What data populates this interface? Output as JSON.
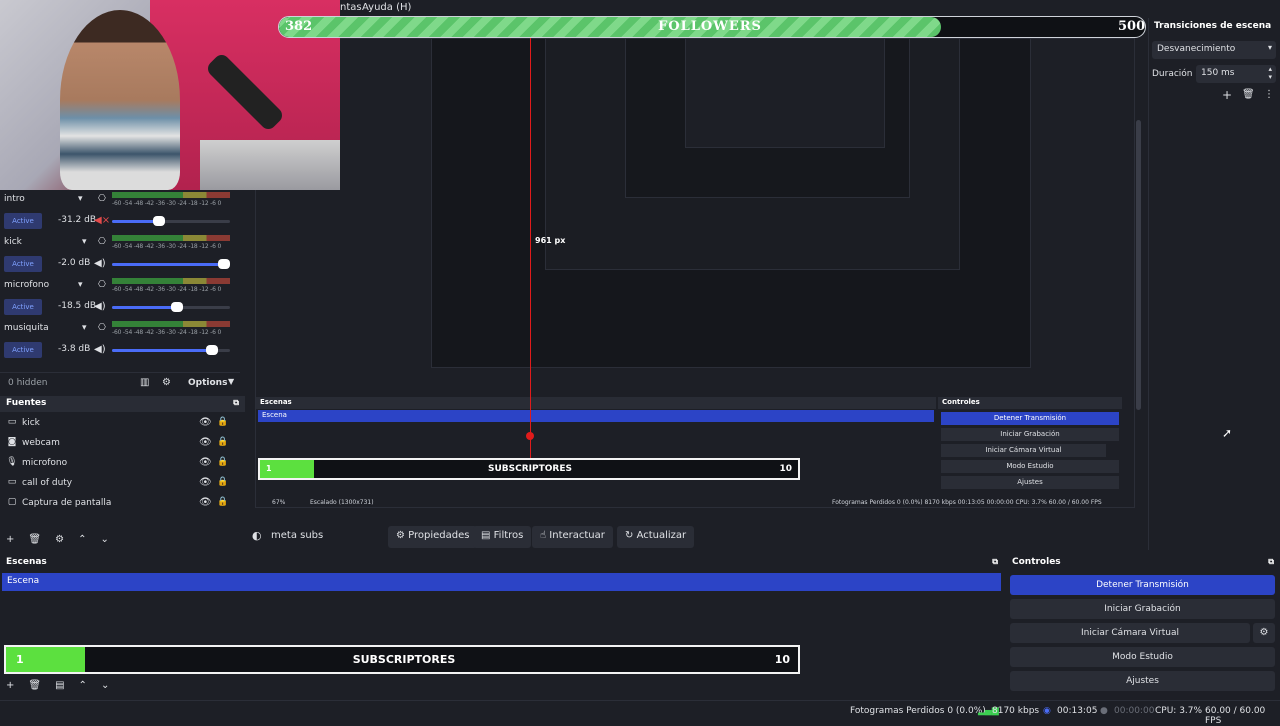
{
  "menu": {
    "items": [
      "ntas",
      "Ayuda (H)"
    ]
  },
  "followers": {
    "current": "382",
    "title": "FOLLOWERS",
    "goal": "500",
    "progress": 0.764
  },
  "mixer": {
    "rows": [
      {
        "name": "intro",
        "state": "Active",
        "db": "-31.2 dB",
        "level": 0.4
      },
      {
        "name": "kick",
        "state": "Active",
        "db": "-2.0 dB",
        "level": 0.95
      },
      {
        "name": "microfono",
        "state": "Active",
        "db": "-18.5 dB",
        "level": 0.55
      },
      {
        "name": "musiquita",
        "state": "Active",
        "db": "-3.8 dB",
        "level": 0.85
      }
    ],
    "scale": "-60 -54 -48 -42 -36 -30 -24 -18 -12 -6 0",
    "hidden": "0 hidden",
    "options": "Options"
  },
  "fuentes": {
    "title": "Fuentes",
    "items": [
      {
        "label": "kick",
        "icon": "display-icon"
      },
      {
        "label": "webcam",
        "icon": "camera-icon"
      },
      {
        "label": "microfono",
        "icon": "mic-icon"
      },
      {
        "label": "call of duty",
        "icon": "display-icon"
      },
      {
        "label": "Captura de pantalla",
        "icon": "monitor-icon"
      }
    ]
  },
  "inner": {
    "escenas_title": "Escenas",
    "escena": "Escena",
    "controles_title": "Controles",
    "controls": [
      "Detener Transmisión",
      "Iniciar Grabación",
      "Iniciar Cámara Virtual",
      "Modo Estudio",
      "Ajustes"
    ],
    "subs_current": "1",
    "subs_title": "SUBSCRIPTORES",
    "subs_goal": "10",
    "zoom": "67%",
    "scale_label": "Escalado (1300x731)",
    "status": "Fotogramas Perdidos 0 (0.0%)   8170 kbps   00:13:05   00:00:00   CPU: 3.7%   60.00 / 60.00 FPS",
    "px_label": "961 px"
  },
  "toolbar": {
    "source_name": "meta subs",
    "propiedades": "Propiedades",
    "filtros": "Filtros",
    "interactuar": "Interactuar",
    "actualizar": "Actualizar"
  },
  "escenas": {
    "title": "Escenas",
    "selected": "Escena"
  },
  "subs": {
    "current": "1",
    "title": "SUBSCRIPTORES",
    "goal": "10",
    "progress": 0.1
  },
  "controles": {
    "title": "Controles",
    "detener": "Detener Transmisión",
    "grabacion": "Iniciar Grabación",
    "camara": "Iniciar Cámara Virtual",
    "estudio": "Modo Estudio",
    "ajustes": "Ajustes"
  },
  "transitions": {
    "title": "Transiciones de escena",
    "selected": "Desvanecimiento",
    "duration_label": "Duración",
    "duration": "150 ms"
  },
  "status": {
    "dropped": "Fotogramas Perdidos 0 (0.0%)",
    "kbps": "8170 kbps",
    "stream_time": "00:13:05",
    "rec_time": "00:00:00",
    "cpu": "CPU: 3.7%",
    "fps": "60.00 / 60.00 FPS"
  },
  "colors": {
    "accent": "#2c44c6",
    "subs_fill": "#5ce03f",
    "followers_fill": "#7fd98a"
  }
}
